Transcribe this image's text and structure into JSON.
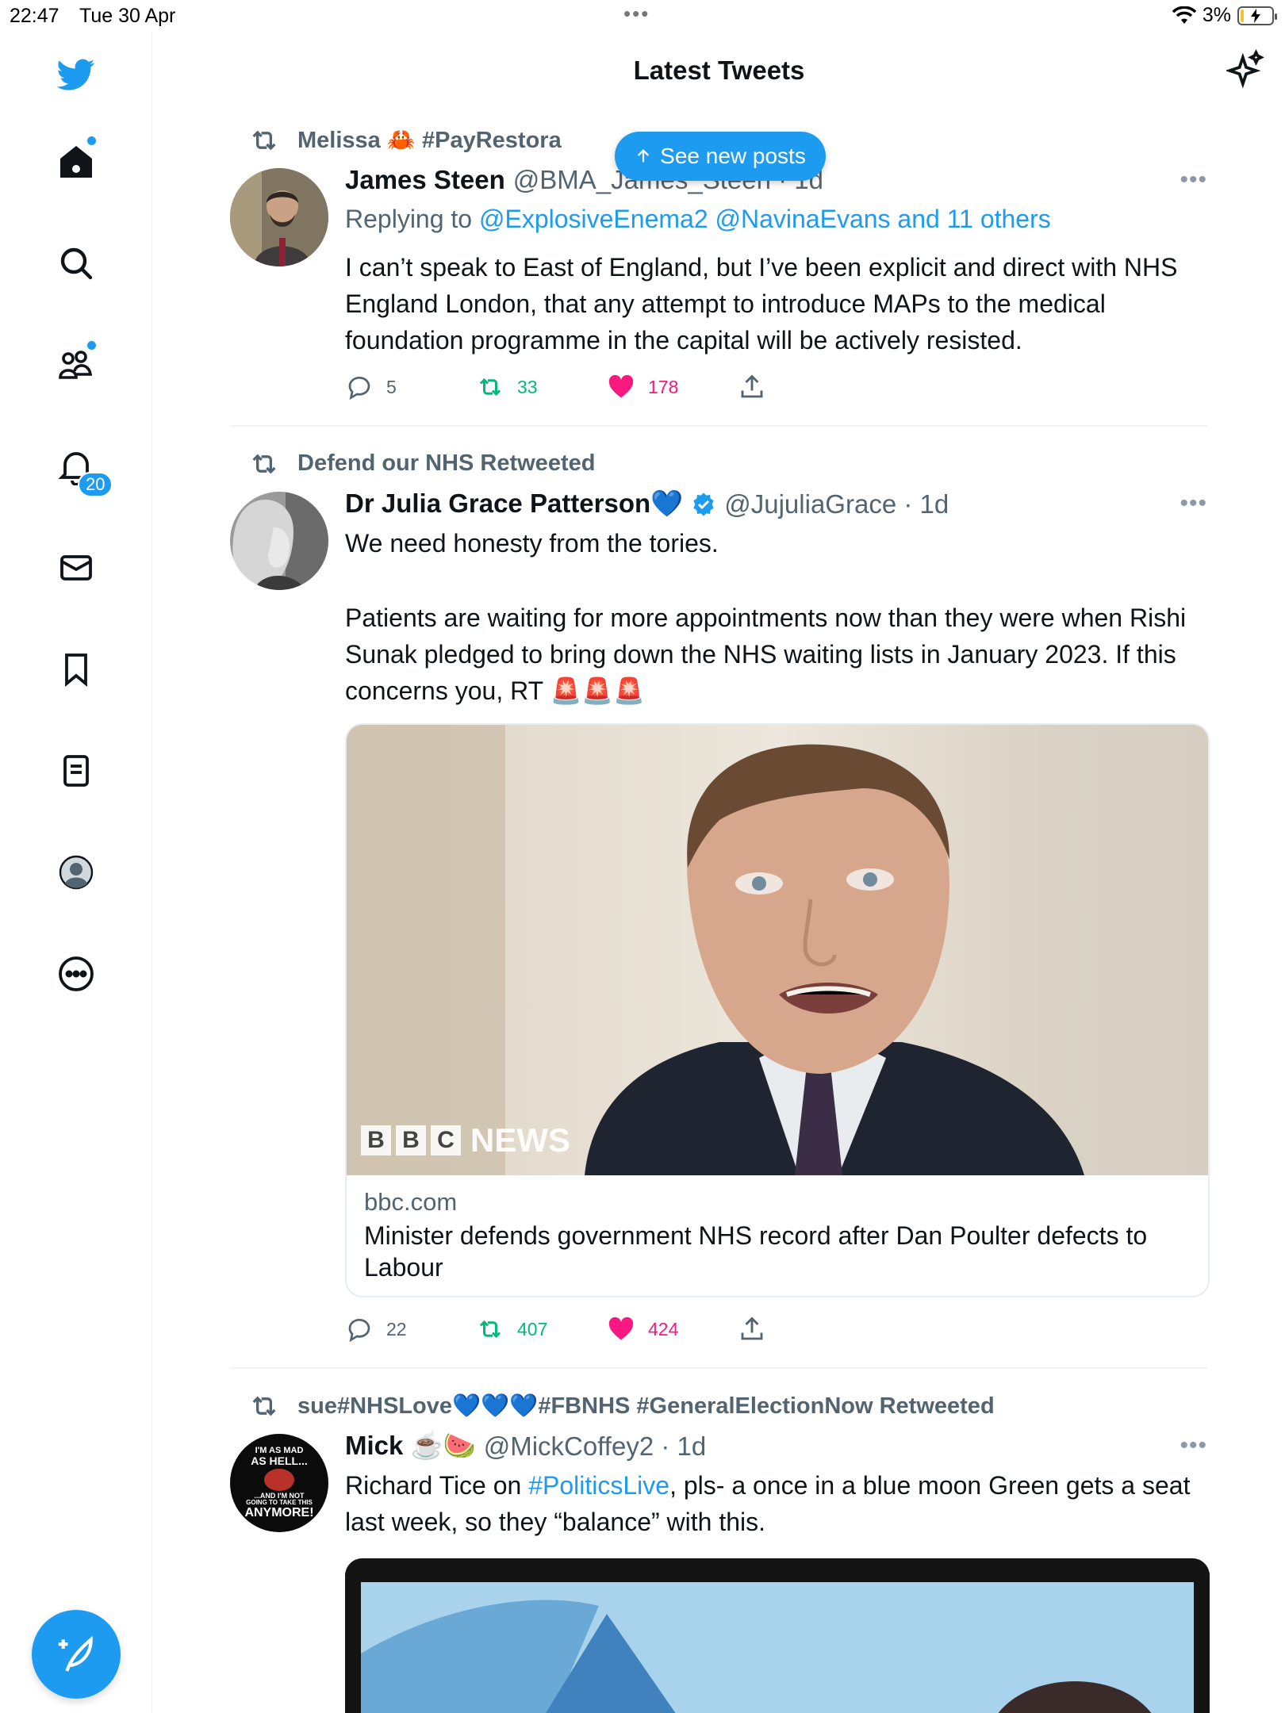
{
  "status_bar": {
    "time": "22:47",
    "date": "Tue 30 Apr",
    "center_dots": "•••",
    "battery": "3%"
  },
  "sidebar": {
    "notifications_badge": "20",
    "icons": [
      "twitter-logo-icon",
      "home-icon",
      "search-icon",
      "communities-icon",
      "notifications-icon",
      "messages-icon",
      "bookmarks-icon",
      "lists-icon",
      "profile-icon",
      "more-icon"
    ]
  },
  "header": {
    "title": "Latest Tweets"
  },
  "new_posts_pill": {
    "label": "See new posts"
  },
  "tweets": [
    {
      "retweeted_by": "Melissa 🦀 #PayRestora",
      "name": "James Steen",
      "handle": "@BMA_James_Steen · 1d",
      "reply_prefix": "Replying to",
      "reply_to": "@ExplosiveEnema2 @NavinaEvans and 11 others",
      "text": "I can’t speak to East of England, but I’ve been explicit and direct with NHS England London, that any attempt to introduce MAPs to the medical foundation programme in the capital will be actively resisted.",
      "replies": "5",
      "retweets": "33",
      "likes": "178"
    },
    {
      "retweeted_by": "Defend our NHS Retweeted",
      "name": "Dr Julia Grace Patterson💙",
      "handle": "@JujuliaGrace · 1d",
      "text_1": "We need honesty from the tories.",
      "text_2": "Patients are waiting for more appointments now than they were when Rishi Sunak pledged to bring down the NHS waiting lists in January 2023. If this concerns you, RT 🚨🚨🚨",
      "card": {
        "image_watermark": "NEWS",
        "bbc_letters": [
          "B",
          "B",
          "C"
        ],
        "domain": "bbc.com",
        "title": "Minister defends government NHS record after Dan Poulter defects to Labour"
      },
      "replies": "22",
      "retweets": "407",
      "likes": "424"
    },
    {
      "retweeted_by": "sue#NHSLove💙💙💙#FBNHS #GeneralElectionNow Retweeted",
      "name": "Mick ☕️🍉",
      "handle": "@MickCoffey2 · 1d",
      "text_prefix": "Richard Tice on ",
      "text_link": "#PoliticsLive",
      "text_suffix": ", pls- a once in a blue moon Green gets a seat last week, so they “balance” with this.",
      "avatar_text": [
        "I'M AS MAD",
        "AS HELL...",
        "...AND I'M NOT",
        "GOING TO TAKE THIS",
        "ANYMORE!"
      ]
    }
  ],
  "colors": {
    "accent": "#1d9bf0",
    "retweet_green": "#00ba7c",
    "like_pink": "#f91880",
    "secondary_text": "#536471"
  }
}
